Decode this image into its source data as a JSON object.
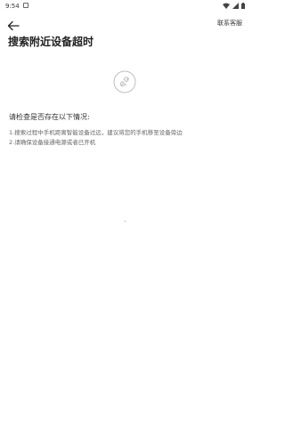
{
  "status_bar": {
    "time": "9:54"
  },
  "header": {
    "back_icon": "arrow-left-icon",
    "support_label": "联系客服"
  },
  "page": {
    "title": "搜索附近设备超时"
  },
  "illustration": {
    "icon": "disconnected-plug-icon"
  },
  "checklist": {
    "title": "请检查是否存在以下情况:",
    "items": [
      "1.搜索过程中手机距离智能设备过远，建议将您的手机移至设备旁边",
      "2.请确保设备接通电源或者已开机"
    ]
  }
}
